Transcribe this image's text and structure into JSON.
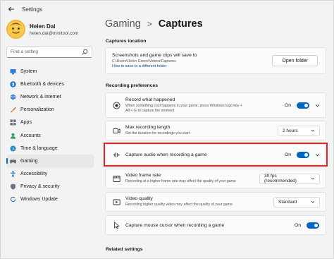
{
  "window": {
    "title": "Settings"
  },
  "profile": {
    "name": "Helen Dai",
    "email": "helen.dai@minitool.com"
  },
  "search": {
    "placeholder": "Find a setting"
  },
  "nav": {
    "items": [
      {
        "label": "System",
        "icon": "monitor-icon"
      },
      {
        "label": "Bluetooth & devices",
        "icon": "bluetooth-icon"
      },
      {
        "label": "Network & internet",
        "icon": "network-icon"
      },
      {
        "label": "Personalization",
        "icon": "brush-icon"
      },
      {
        "label": "Apps",
        "icon": "apps-icon"
      },
      {
        "label": "Accounts",
        "icon": "person-icon"
      },
      {
        "label": "Time & language",
        "icon": "globe-clock-icon"
      },
      {
        "label": "Gaming",
        "icon": "gamepad-icon",
        "active": true
      },
      {
        "label": "Accessibility",
        "icon": "accessibility-icon"
      },
      {
        "label": "Privacy & security",
        "icon": "shield-icon"
      },
      {
        "label": "Windows Update",
        "icon": "update-icon"
      }
    ]
  },
  "breadcrumb": {
    "parent": "Gaming",
    "separator": ">",
    "current": "Captures"
  },
  "captures_location": {
    "section_title": "Captures location",
    "title": "Screenshots and game clips will save to",
    "path": "C:\\Users\\Helen Green\\Videos\\Captures",
    "link": "How to save to a different folder",
    "button": "Open folder"
  },
  "recording": {
    "section_title": "Recording preferences",
    "record_what_happened": {
      "title": "Record what happened",
      "sub1": "When something cool happens in your game, press Windows logo key +",
      "sub2": "Alt + G to capture the moment",
      "toggle_label": "On"
    },
    "max_length": {
      "title": "Max recording length",
      "sub": "Set the duration for recordings you start",
      "value": "2 hours"
    },
    "capture_audio": {
      "title": "Capture audio when recording a game",
      "toggle_label": "On"
    },
    "frame_rate": {
      "title": "Video frame rate",
      "sub1": "Recording at a higher frame rate may affect the quality of your game",
      "value": "30 fps (recommended)"
    },
    "video_quality": {
      "title": "Video quality",
      "sub1": "Recording higher quality video may affect the quality of your game",
      "value": "Standard"
    },
    "mouse_cursor": {
      "title": "Capture mouse cursor when recording a game",
      "toggle_label": "On"
    }
  },
  "related": {
    "section_title": "Related settings"
  },
  "colors": {
    "accent": "#0067c0",
    "highlight": "#d62b2b"
  }
}
